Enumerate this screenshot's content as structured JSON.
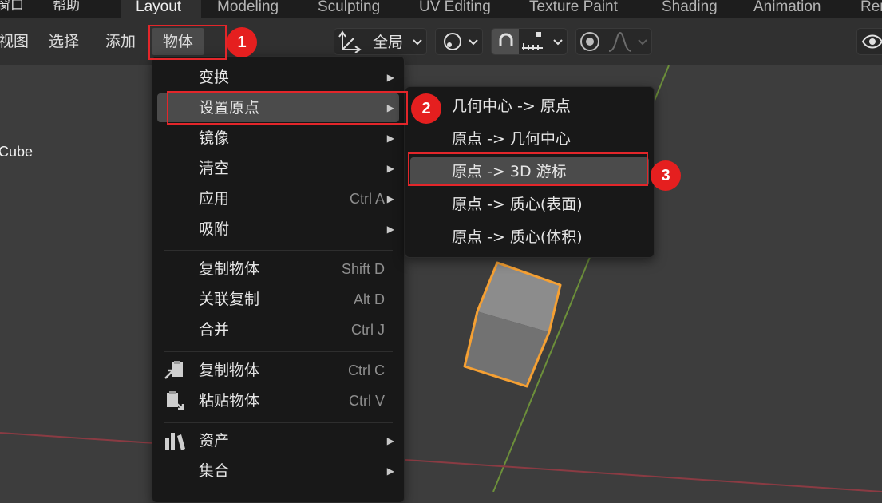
{
  "topbar": {
    "menu_window": "窗口",
    "menu_help": "帮助",
    "tabs": [
      "Layout",
      "Modeling",
      "Sculpting",
      "UV Editing",
      "Texture Paint",
      "Shading",
      "Animation",
      "Ren"
    ]
  },
  "header": {
    "menus": [
      "视图",
      "选择",
      "添加",
      "物体"
    ],
    "transform_orientation": "全局"
  },
  "viewport": {
    "object_label": "Cube"
  },
  "object_menu": {
    "items": [
      {
        "label": "变换",
        "shortcut": "",
        "submenu": true
      },
      {
        "label": "设置原点",
        "shortcut": "",
        "submenu": true
      },
      {
        "label": "镜像",
        "shortcut": "",
        "submenu": true
      },
      {
        "label": "清空",
        "shortcut": "",
        "submenu": true
      },
      {
        "label": "应用",
        "shortcut": "Ctrl A",
        "submenu": true
      },
      {
        "label": "吸附",
        "shortcut": "",
        "submenu": true
      },
      {
        "label": "复制物体",
        "shortcut": "Shift D",
        "submenu": false
      },
      {
        "label": "关联复制",
        "shortcut": "Alt D",
        "submenu": false
      },
      {
        "label": "合并",
        "shortcut": "Ctrl J",
        "submenu": false
      },
      {
        "label": "复制物体",
        "shortcut": "Ctrl C",
        "submenu": false
      },
      {
        "label": "粘贴物体",
        "shortcut": "Ctrl V",
        "submenu": false
      },
      {
        "label": "资产",
        "shortcut": "",
        "submenu": true
      },
      {
        "label": "集合",
        "shortcut": "",
        "submenu": true
      }
    ]
  },
  "origin_submenu": {
    "items": [
      "几何中心 -> 原点",
      "原点 -> 几何中心",
      "原点 -> 3D 游标",
      "原点 -> 质心(表面)",
      "原点 -> 质心(体积)"
    ]
  },
  "annotations": [
    "1",
    "2",
    "3"
  ],
  "colors": {
    "highlight_red": "#e3262a",
    "selection_orange": "#f5a033"
  }
}
